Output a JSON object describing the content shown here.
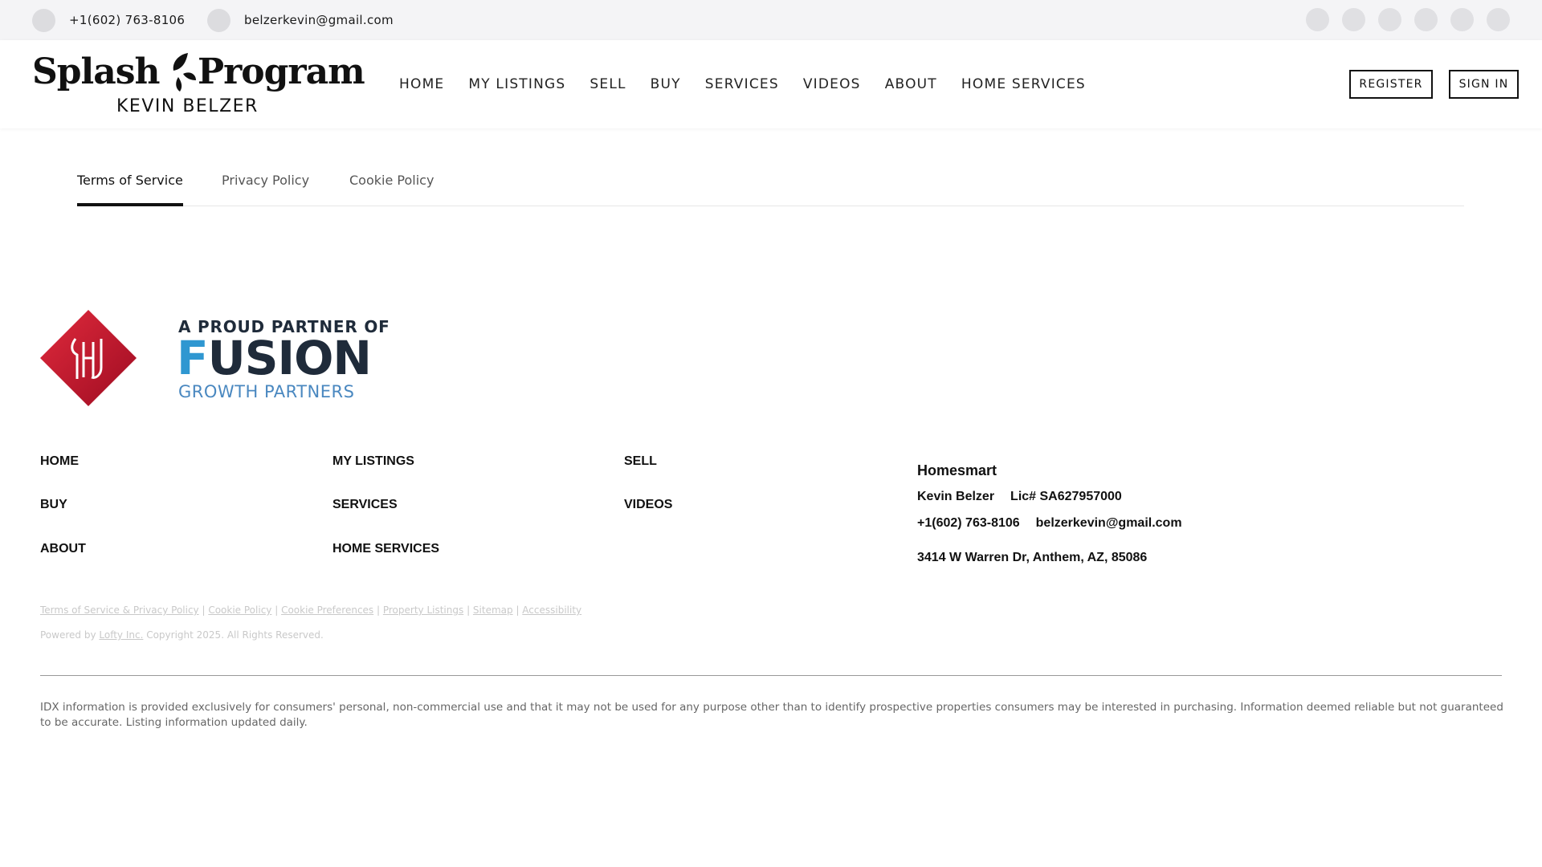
{
  "topbar": {
    "phone": "+1(602) 763-8106",
    "email": "belzerkevin@gmail.com",
    "social_icons": [
      "social-icon-1",
      "social-icon-2",
      "social-icon-3",
      "social-icon-4",
      "social-icon-5",
      "social-icon-6"
    ]
  },
  "header": {
    "logo": {
      "word1": "Splash",
      "word2": "Program",
      "subtitle": "KEVIN BELZER"
    },
    "nav": [
      "HOME",
      "MY LISTINGS",
      "SELL",
      "BUY",
      "SERVICES",
      "VIDEOS",
      "ABOUT",
      "HOME SERVICES"
    ],
    "register_label": "REGISTER",
    "signin_label": "SIGN IN"
  },
  "tabs": [
    {
      "label": "Terms of Service",
      "active": true
    },
    {
      "label": "Privacy Policy",
      "active": false
    },
    {
      "label": "Cookie Policy",
      "active": false
    }
  ],
  "footer": {
    "partner": {
      "line1": "A PROUD PARTNER OF",
      "line2a": "F",
      "line2b": "USION",
      "line3": "GROWTH PARTNERS"
    },
    "nav": {
      "home": "HOME",
      "my_listings": "MY LISTINGS",
      "sell": "SELL",
      "buy": "BUY",
      "services": "SERVICES",
      "videos": "VIDEOS",
      "about": "ABOUT",
      "home_services": "HOME SERVICES"
    },
    "agent": {
      "brokerage": "Homesmart",
      "name": "Kevin Belzer",
      "license": "Lic# SA627957000",
      "phone": "+1(602) 763-8106",
      "email": "belzerkevin@gmail.com",
      "address": "3414 W Warren Dr, Anthem, AZ, 85086"
    },
    "legal_links": [
      "Terms of Service & Privacy Policy",
      "Cookie Policy",
      "Cookie Preferences",
      "Property Listings",
      "Sitemap",
      "Accessibility"
    ],
    "separator": " | ",
    "powered_prefix": "Powered by ",
    "powered_link": "Lofty Inc.",
    "powered_suffix": " Copyright 2025. All Rights Reserved.",
    "idx_disclaimer": "IDX information is provided exclusively for consumers' personal, non-commercial use and that it may not be used for any purpose other than to identify prospective properties consumers may be interested in purchasing. Information deemed reliable but not guaranteed to be accurate. Listing information updated daily."
  },
  "colors": {
    "topbar_bg": "#f4f4f6",
    "hs_red": "#c8102e",
    "fusion_navy": "#1f2b3a",
    "fusion_blue": "#2f97d1"
  }
}
